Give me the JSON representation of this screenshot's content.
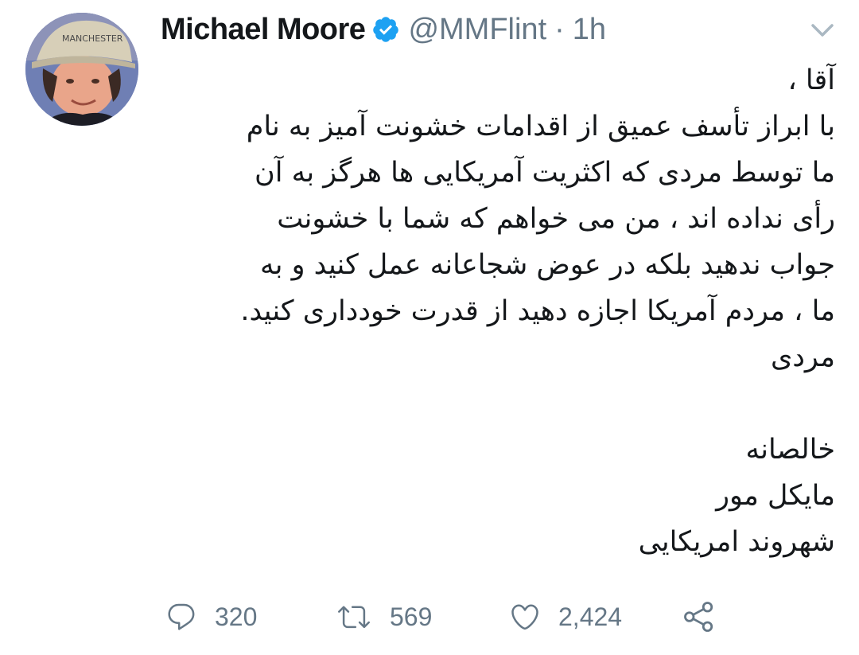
{
  "tweet": {
    "author": {
      "name": "Michael Moore",
      "handle": "@MMFlint",
      "verified": true,
      "avatar_icon": "profile-photo"
    },
    "separator": "·",
    "time": "1h",
    "text_lines": [
      "آقا ،",
      "با ابراز تأسف عمیق از اقدامات خشونت آمیز به نام",
      "ما توسط مردی که اکثریت آمریکایی ها هرگز به آن",
      "رأی نداده اند ، من می خواهم که شما با خشونت",
      "جواب ندهید بلکه در عوض شجاعانه عمل کنید و به",
      "ما ، مردم آمریکا اجازه دهید از قدرت خودداری کنید.",
      "مردی",
      "",
      "خالصانه",
      "مایکل مور",
      "شهروند امریکایی"
    ],
    "actions": {
      "reply_count": "320",
      "retweet_count": "569",
      "like_count": "2,424"
    }
  },
  "colors": {
    "text": "#14171a",
    "muted": "#657786",
    "verified": "#1da1f2",
    "chevron": "#aab8c2"
  },
  "icons": {
    "verified": "verified-badge-icon",
    "menu": "chevron-down-icon",
    "reply": "reply-icon",
    "retweet": "retweet-icon",
    "like": "heart-icon",
    "share": "share-icon"
  }
}
